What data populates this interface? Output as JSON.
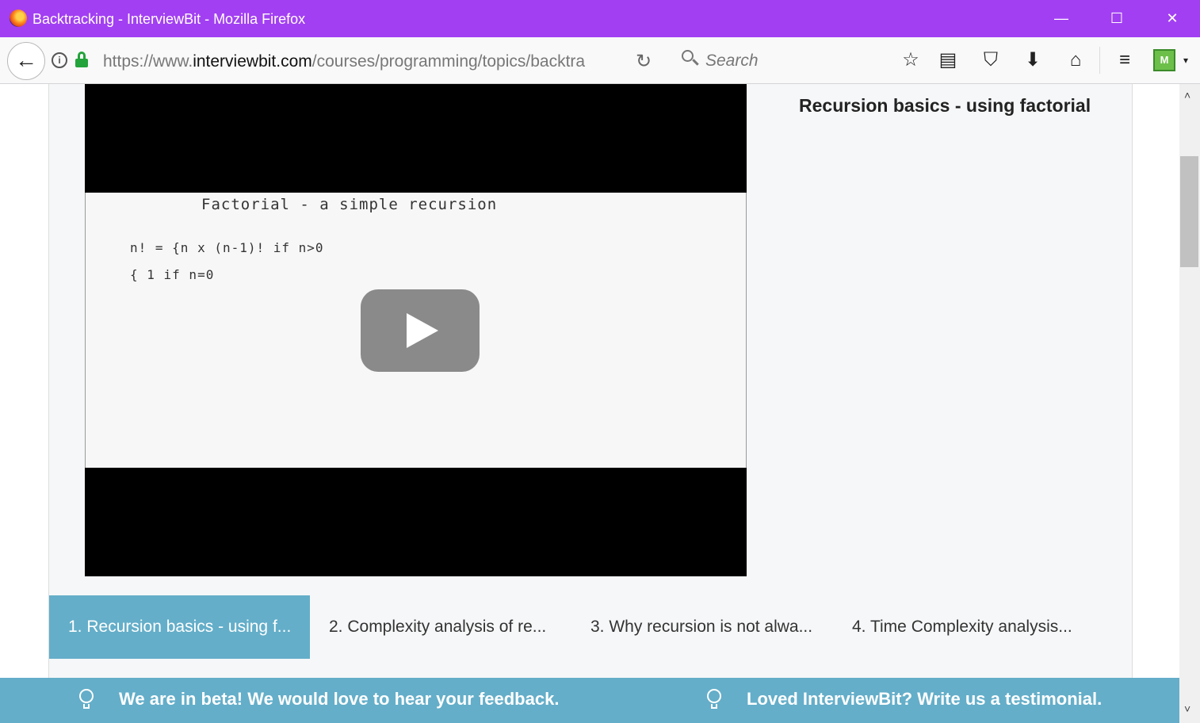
{
  "window": {
    "title": "Backtracking - InterviewBit - Mozilla Firefox",
    "minimize": "—",
    "maximize": "☐",
    "close": "✕"
  },
  "navbar": {
    "back": "←",
    "info": "i",
    "url_prefix": "https://www.",
    "url_host": "interviewbit.com",
    "url_path": "/courses/programming/topics/backtra",
    "reload": "↻",
    "search_placeholder": "Search",
    "icons": {
      "bookmark": "☆",
      "reading_list": "▤",
      "pocket": "⛉",
      "download": "⬇",
      "home": "⌂",
      "menu": "≡",
      "extension": "M",
      "extension_caret": "▾"
    }
  },
  "video": {
    "slide_title": "Factorial - a simple recursion",
    "line1": "n! = {n x (n-1)!   if n>0",
    "line2": "     { 1            if n=0",
    "title": "Recursion basics - using factorial"
  },
  "playlist": [
    {
      "label": "1. Recursion basics - using f...",
      "active": true
    },
    {
      "label": "2. Complexity analysis of re...",
      "active": false
    },
    {
      "label": "3. Why recursion is not alwa...",
      "active": false
    },
    {
      "label": "4. Time Complexity analysis...",
      "active": false
    }
  ],
  "banner": {
    "left": "We are in beta! We would love to hear your feedback.",
    "right": "Loved InterviewBit? Write us a testimonial."
  },
  "scrollbar": {
    "up": "˄",
    "down": "˅"
  },
  "colors": {
    "titlebar": "#a23ff2",
    "accent": "#64aec9",
    "lock": "#23a33b"
  }
}
